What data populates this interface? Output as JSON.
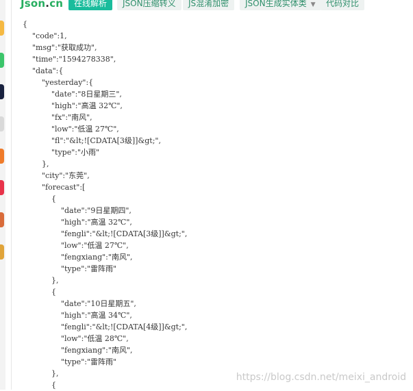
{
  "toolbar": {
    "logo_main": "Json",
    "logo_dot": ".",
    "logo_suffix": "cn",
    "buttons": [
      {
        "label": "在线解析"
      },
      {
        "label": "JSON压缩转义"
      },
      {
        "label": "JS混淆加密"
      },
      {
        "label": "JSON生成实体类"
      },
      {
        "label": "代码对比"
      }
    ]
  },
  "json_lines": [
    "{",
    "    \"code\":1,",
    "    \"msg\":\"获取成功\",",
    "    \"time\":\"1594278338\",",
    "    \"data\":{",
    "        \"yesterday\":{",
    "            \"date\":\"8日星期三\",",
    "            \"high\":\"高温 32℃\",",
    "            \"fx\":\"南风\",",
    "            \"low\":\"低温 27℃\",",
    "            \"fl\":\"&lt;![CDATA[3级]]&gt;\",",
    "            \"type\":\"小雨\"",
    "        },",
    "        \"city\":\"东莞\",",
    "        \"forecast\":[",
    "            {",
    "                \"date\":\"9日星期四\",",
    "                \"high\":\"高温 32℃\",",
    "                \"fengli\":\"&lt;![CDATA[3级]]&gt;\",",
    "                \"low\":\"低温 27℃\",",
    "                \"fengxiang\":\"南风\",",
    "                \"type\":\"雷阵雨\"",
    "            },",
    "            {",
    "                \"date\":\"10日星期五\",",
    "                \"high\":\"高温 34℃\",",
    "                \"fengli\":\"&lt;![CDATA[4级]]&gt;\",",
    "                \"low\":\"低温 28℃\",",
    "                \"fengxiang\":\"南风\",",
    "                \"type\":\"雷阵雨\"",
    "            },",
    "            {"
  ],
  "watermark": "https://blog.csdn.net/meixi_android",
  "colors": {
    "accent": "#1abc9c",
    "logo": "#27ae60"
  }
}
